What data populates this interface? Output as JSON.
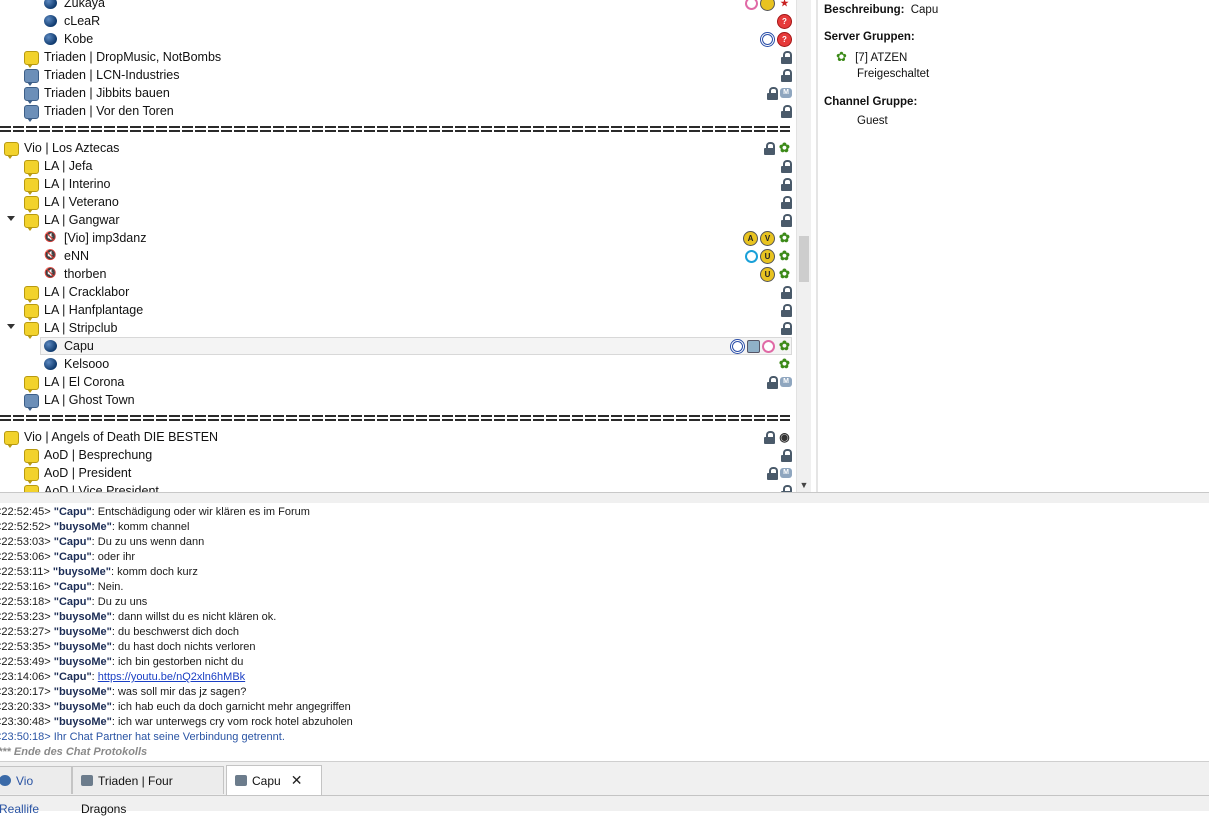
{
  "tree": {
    "rows": [
      {
        "kind": "user",
        "label": "Zukaya",
        "indent": 2,
        "right": [
          "pink-headset",
          "yellow-circle",
          "star"
        ]
      },
      {
        "kind": "user",
        "label": "cLeaR",
        "indent": 2,
        "right": [
          "red-question"
        ]
      },
      {
        "kind": "user",
        "label": "Kobe",
        "indent": 2,
        "right": [
          "blue-badge",
          "red-question"
        ]
      },
      {
        "kind": "chan-y",
        "label": "Triaden | DropMusic, NotBombs",
        "indent": 1,
        "right": [
          "lock"
        ]
      },
      {
        "kind": "chan-b",
        "label": "Triaden | LCN-Industries",
        "indent": 1,
        "right": [
          "lock"
        ]
      },
      {
        "kind": "chan-b",
        "label": "Triaden | Jibbits bauen",
        "indent": 1,
        "right": [
          "lock",
          "m-bubble"
        ]
      },
      {
        "kind": "chan-b",
        "label": "Triaden | Vor den Toren",
        "indent": 1,
        "right": [
          "lock"
        ]
      },
      {
        "kind": "sep"
      },
      {
        "kind": "chan-y",
        "label": "Vio | Los Aztecas",
        "indent": 0,
        "right": [
          "lock",
          "leaf"
        ]
      },
      {
        "kind": "chan-y",
        "label": "LA | Jefa",
        "indent": 1,
        "right": [
          "lock"
        ]
      },
      {
        "kind": "chan-y",
        "label": "LA | Interino",
        "indent": 1,
        "right": [
          "lock"
        ]
      },
      {
        "kind": "chan-y",
        "label": "LA | Veterano",
        "indent": 1,
        "right": [
          "lock"
        ]
      },
      {
        "kind": "chan-y",
        "label": "LA | Gangwar",
        "indent": 1,
        "expanded": true,
        "right": [
          "lock"
        ]
      },
      {
        "kind": "muted",
        "label": "[Vio] imp3danz",
        "indent": 2,
        "right": [
          "a-badge",
          "v-badge",
          "leaf"
        ]
      },
      {
        "kind": "muted",
        "label": "eNN",
        "indent": 2,
        "right": [
          "cyan-pin",
          "u-badge",
          "leaf"
        ]
      },
      {
        "kind": "muted",
        "label": "thorben",
        "indent": 2,
        "right": [
          "u-badge",
          "leaf"
        ]
      },
      {
        "kind": "chan-y",
        "label": "LA | Cracklabor",
        "indent": 1,
        "right": [
          "lock"
        ]
      },
      {
        "kind": "chan-y",
        "label": "LA | Hanfplantage",
        "indent": 1,
        "right": [
          "lock"
        ]
      },
      {
        "kind": "chan-y",
        "label": "LA | Stripclub",
        "indent": 1,
        "expanded": true,
        "right": [
          "lock"
        ]
      },
      {
        "kind": "user",
        "label": "Capu",
        "indent": 2,
        "selected": true,
        "right": [
          "blue-badge",
          "picture",
          "pink-headset",
          "leaf"
        ]
      },
      {
        "kind": "user",
        "label": "Kelsooo",
        "indent": 2,
        "right": [
          "leaf"
        ]
      },
      {
        "kind": "chan-y",
        "label": "LA | El Corona",
        "indent": 1,
        "right": [
          "lock",
          "m-bubble"
        ]
      },
      {
        "kind": "chan-b",
        "label": "LA | Ghost Town",
        "indent": 1,
        "right": []
      },
      {
        "kind": "sep"
      },
      {
        "kind": "chan-y",
        "label": "Vio | Angels of Death DIE BESTEN",
        "indent": 0,
        "right": [
          "lock",
          "eye"
        ]
      },
      {
        "kind": "chan-y",
        "label": "AoD | Besprechung",
        "indent": 1,
        "right": [
          "lock"
        ]
      },
      {
        "kind": "chan-y",
        "label": "AoD | President",
        "indent": 1,
        "right": [
          "lock",
          "m-bubble"
        ]
      },
      {
        "kind": "chan-y",
        "label": "AoD | Vice President",
        "indent": 1,
        "right": [
          "lock"
        ]
      }
    ]
  },
  "info": {
    "description_label": "Beschreibung:",
    "description_value": "Capu",
    "server_groups_label": "Server Gruppen:",
    "server_group_name": "[7] ATZEN",
    "server_group_2": "Freigeschaltet",
    "channel_group_label": "Channel Gruppe:",
    "channel_group_value": "Guest"
  },
  "chat": {
    "lines": [
      {
        "time": "<22:52:45>",
        "nick": "\"Capu\"",
        "text": ": Entschädigung oder wir klären es im Forum"
      },
      {
        "time": "<22:52:52>",
        "nick": "\"buysoMe\"",
        "text": ": komm channel"
      },
      {
        "time": "<22:53:03>",
        "nick": "\"Capu\"",
        "text": ": Du zu uns wenn dann"
      },
      {
        "time": "<22:53:06>",
        "nick": "\"Capu\"",
        "text": ": oder ihr"
      },
      {
        "time": "<22:53:11>",
        "nick": "\"buysoMe\"",
        "text": ": komm doch kurz"
      },
      {
        "time": "<22:53:16>",
        "nick": "\"Capu\"",
        "text": ": Nein."
      },
      {
        "time": "<22:53:18>",
        "nick": "\"Capu\"",
        "text": ": Du zu uns"
      },
      {
        "time": "<22:53:23>",
        "nick": "\"buysoMe\"",
        "text": ": dann willst du es nicht klären ok."
      },
      {
        "time": "<22:53:27>",
        "nick": "\"buysoMe\"",
        "text": ": du beschwerst dich doch"
      },
      {
        "time": "<22:53:35>",
        "nick": "\"buysoMe\"",
        "text": ": du hast doch nichts verloren"
      },
      {
        "time": "<22:53:49>",
        "nick": "\"buysoMe\"",
        "text": ": ich bin gestorben nicht du"
      },
      {
        "time": "<23:14:06>",
        "nick": "\"Capu\"",
        "text": ": ",
        "link": "https://youtu.be/nQ2xln6hMBk"
      },
      {
        "time": "<23:20:17>",
        "nick": "\"buysoMe\"",
        "text": ": was soll mir das jz sagen?"
      },
      {
        "time": "<23:20:33>",
        "nick": "\"buysoMe\"",
        "text": ": ich hab euch da doch garnicht mehr angegriffen"
      },
      {
        "time": "<23:30:48>",
        "nick": "\"buysoMe\"",
        "text": ": ich war unterwegs cry vom rock hotel abzuholen"
      }
    ],
    "system_time": "<23:50:18>",
    "system_text": " Ihr Chat Partner hat seine Verbindung getrennt.",
    "end_text": "*** Ende des Chat Protokolls"
  },
  "tabs": {
    "items": [
      {
        "label": "Vio Reallife",
        "active": false
      },
      {
        "label": "Triaden | Four Dragons",
        "active": false
      },
      {
        "label": "Capu",
        "active": true
      }
    ],
    "close_glyph": "✕"
  },
  "colors": {
    "link": "#1a3fc4",
    "nick": "#1b2c55",
    "system": "#2a54a4",
    "leaf": "#3c8a18"
  }
}
